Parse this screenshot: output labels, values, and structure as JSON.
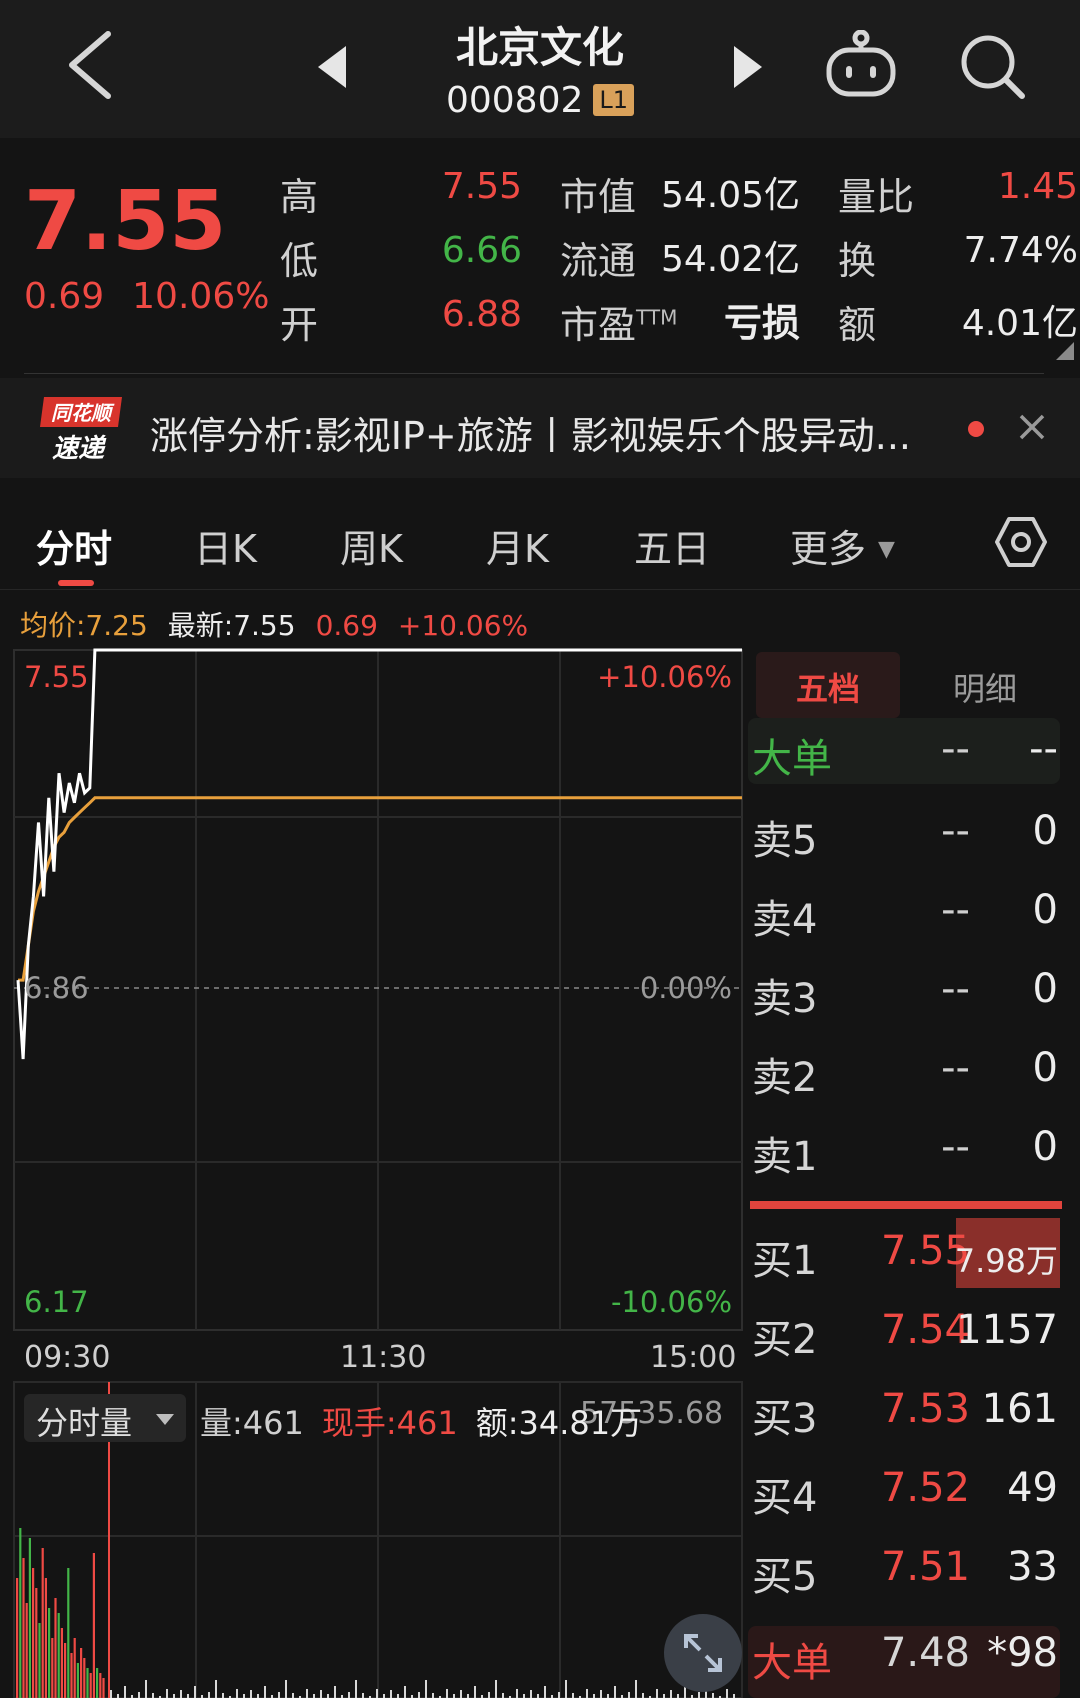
{
  "header": {
    "title": "北京文化",
    "code": "000802",
    "level": "L1"
  },
  "quote": {
    "price": "7.55",
    "change": "0.69",
    "change_pct": "10.06%",
    "high_label": "高",
    "high": "7.55",
    "low_label": "低",
    "low": "6.66",
    "open_label": "开",
    "open": "6.88",
    "mcap_label": "市值",
    "mcap": "54.05亿",
    "float_label": "流通",
    "float": "54.02亿",
    "pe_label": "市盈",
    "pe_sup": "TTM",
    "pe": "亏损",
    "vol_ratio_label": "量比",
    "vol_ratio": "1.45",
    "turnover_label": "换",
    "turnover": "7.74%",
    "amount_label": "额",
    "amount": "4.01亿"
  },
  "news": {
    "logo_top": "同花顺",
    "logo_bottom": "速递",
    "text": "涨停分析:影视IP+旅游丨影视娱乐个股异动..."
  },
  "tabs": [
    "分时",
    "日K",
    "周K",
    "月K",
    "五日",
    "更多"
  ],
  "chart_info": {
    "avg": "均价:7.25",
    "latest": "最新:7.55",
    "change": "0.69",
    "change_pct": "+10.06%"
  },
  "chart_data": {
    "type": "line",
    "y_top": "7.55",
    "y_mid": "6.86",
    "y_bottom": "6.17",
    "pct_top": "+10.06%",
    "pct_mid": "0.00%",
    "pct_bottom": "-10.06%",
    "ylim": [
      6.17,
      7.55
    ],
    "x_labels": [
      "09:30",
      "11:30",
      "15:00"
    ],
    "series": [
      {
        "values": [
          6.88,
          6.72,
          6.95,
          7.05,
          7.2,
          7.05,
          7.25,
          7.1,
          7.3,
          7.22,
          7.28,
          7.24,
          7.3,
          7.26,
          7.27,
          7.55,
          7.55
        ]
      },
      {
        "values": [
          6.88,
          6.88,
          6.95,
          7.02,
          7.06,
          7.09,
          7.12,
          7.15,
          7.17,
          7.18,
          7.2,
          7.21,
          7.22,
          7.23,
          7.24,
          7.25,
          7.25
        ]
      }
    ],
    "colors": {
      "price": "#ffffff",
      "avg": "#e8a03c"
    }
  },
  "volume": {
    "selector": "分时量",
    "vol": "量:461",
    "hand": "现手:461",
    "amount": "额:34.81万",
    "max": "57535.68"
  },
  "order_book": {
    "tab_active": "五档",
    "tab_other": "明细",
    "big_sell": {
      "label": "大单",
      "price": "--",
      "vol": "--"
    },
    "sells": [
      {
        "label": "卖5",
        "price": "--",
        "vol": "0"
      },
      {
        "label": "卖4",
        "price": "--",
        "vol": "0"
      },
      {
        "label": "卖3",
        "price": "--",
        "vol": "0"
      },
      {
        "label": "卖2",
        "price": "--",
        "vol": "0"
      },
      {
        "label": "卖1",
        "price": "--",
        "vol": "0"
      }
    ],
    "buys": [
      {
        "label": "买1",
        "price": "7.55",
        "vol": "7.98万"
      },
      {
        "label": "买2",
        "price": "7.54",
        "vol": "1157"
      },
      {
        "label": "买3",
        "price": "7.53",
        "vol": "161"
      },
      {
        "label": "买4",
        "price": "7.52",
        "vol": "49"
      },
      {
        "label": "买5",
        "price": "7.51",
        "vol": "33"
      }
    ],
    "big_buy": {
      "label": "大单",
      "price": "7.48",
      "vol": "*98"
    }
  }
}
